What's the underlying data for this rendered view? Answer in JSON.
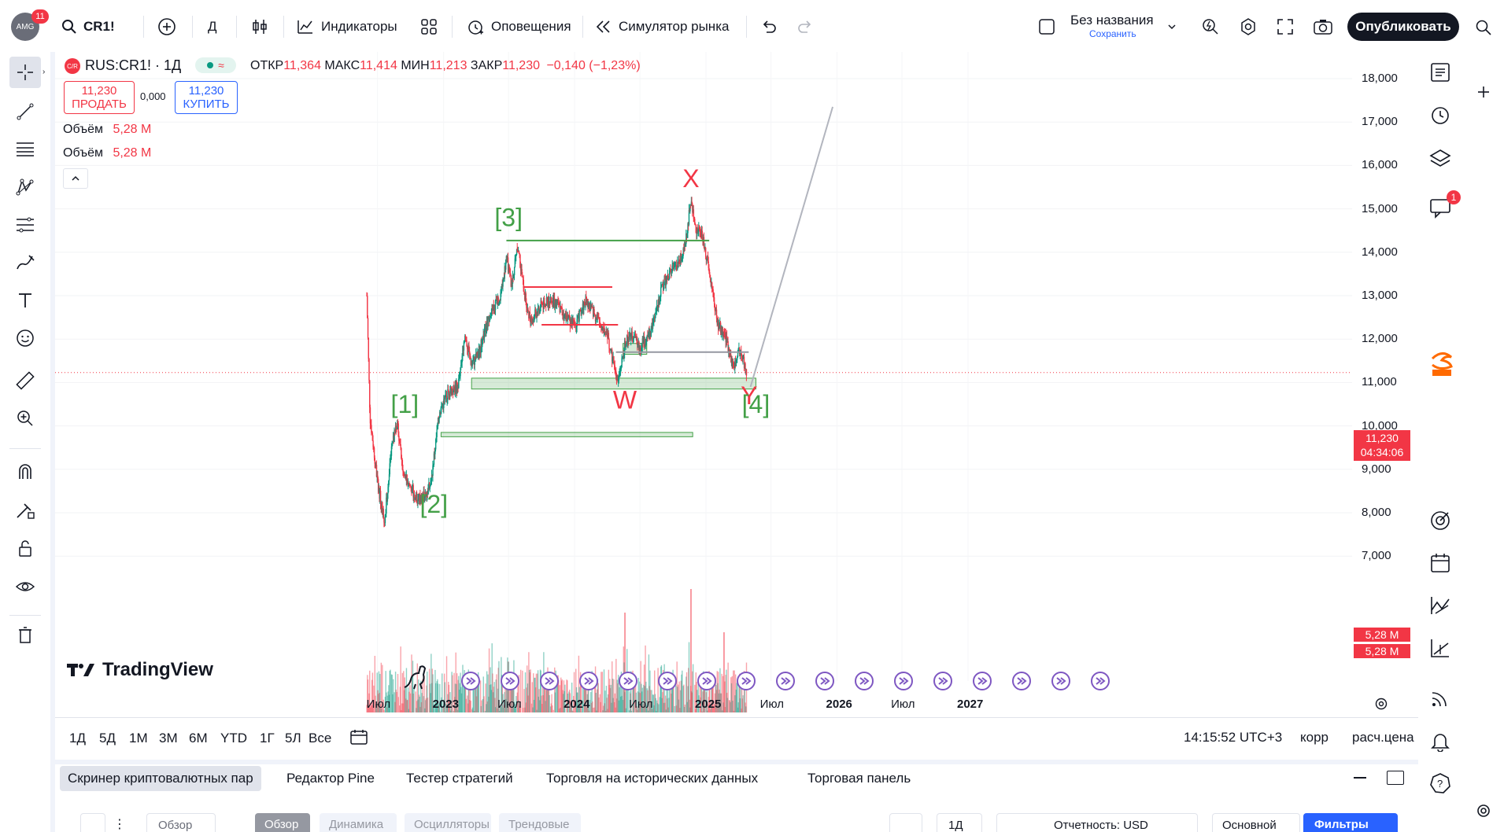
{
  "topbar": {
    "avatar_badge": "11",
    "avatar_text": "AMG",
    "symbol_search": "CR1!",
    "interval": "Д",
    "indicators_label": "Индикаторы",
    "alerts_label": "Оповещения",
    "replay_label": "Симулятор рынка",
    "layout_name": "Без названия",
    "layout_save": "Сохранить",
    "publish_label": "Опубликовать"
  },
  "legend": {
    "symbol": "RUS:CR1! · 1Д",
    "badge": "C/R",
    "open_label": "ОТКР",
    "open": "11,364",
    "high_label": "МАКС",
    "high": "11,414",
    "low_label": "МИН",
    "low": "11,213",
    "close_label": "ЗАКР",
    "close": "11,230",
    "change": "−0,140 (−1,23%)",
    "sell_price": "11,230",
    "sell_label": "ПРОДАТЬ",
    "spread": "0,000",
    "buy_price": "11,230",
    "buy_label": "КУПИТЬ",
    "volume_rows": [
      {
        "label": "Объём",
        "value": "5,28 M"
      },
      {
        "label": "Объём",
        "value": "5,28 M"
      }
    ]
  },
  "chart_data": {
    "type": "candlestick",
    "symbol": "RUS:CR1!",
    "interval": "1Д",
    "y_ticks": [
      "18,000",
      "17,000",
      "16,000",
      "15,000",
      "14,000",
      "13,000",
      "12,000",
      "11,000",
      "10,000",
      "9,000",
      "8,000",
      "7,000"
    ],
    "ylim": [
      6800,
      18300
    ],
    "x_ticks": [
      "Июл",
      "2023",
      "Июл",
      "2024",
      "Июл",
      "2025",
      "Июл",
      "2026",
      "Июл",
      "2027"
    ],
    "price_path": [
      [
        "2022-06-01",
        13000
      ],
      [
        "2022-06-10",
        10200
      ],
      [
        "2022-07-01",
        8700
      ],
      [
        "2022-07-20",
        7800
      ],
      [
        "2022-08-10",
        9500
      ],
      [
        "2022-08-25",
        10100
      ],
      [
        "2022-09-10",
        8900
      ],
      [
        "2022-10-01",
        8600
      ],
      [
        "2022-10-20",
        8300
      ],
      [
        "2022-11-15",
        8400
      ],
      [
        "2022-12-01",
        9000
      ],
      [
        "2022-12-20",
        10300
      ],
      [
        "2023-01-15",
        10800
      ],
      [
        "2023-02-10",
        10900
      ],
      [
        "2023-03-01",
        12100
      ],
      [
        "2023-03-20",
        11400
      ],
      [
        "2023-04-10",
        11700
      ],
      [
        "2023-05-10",
        12600
      ],
      [
        "2023-06-10",
        13000
      ],
      [
        "2023-06-25",
        13900
      ],
      [
        "2023-07-10",
        13200
      ],
      [
        "2023-07-25",
        14200
      ],
      [
        "2023-08-15",
        13000
      ],
      [
        "2023-09-01",
        12400
      ],
      [
        "2023-10-01",
        12800
      ],
      [
        "2023-11-01",
        12900
      ],
      [
        "2023-12-01",
        12600
      ],
      [
        "2024-01-01",
        12300
      ],
      [
        "2024-02-01",
        12900
      ],
      [
        "2024-03-01",
        12500
      ],
      [
        "2024-04-01",
        12100
      ],
      [
        "2024-05-01",
        11000
      ],
      [
        "2024-05-20",
        11900
      ],
      [
        "2024-06-10",
        12100
      ],
      [
        "2024-07-01",
        11800
      ],
      [
        "2024-08-01",
        12200
      ],
      [
        "2024-09-01",
        13200
      ],
      [
        "2024-10-01",
        13600
      ],
      [
        "2024-11-01",
        14000
      ],
      [
        "2024-11-20",
        15200
      ],
      [
        "2024-12-01",
        14600
      ],
      [
        "2024-12-20",
        14400
      ],
      [
        "2025-01-10",
        13600
      ],
      [
        "2025-02-01",
        12400
      ],
      [
        "2025-03-01",
        11900
      ],
      [
        "2025-03-20",
        11300
      ],
      [
        "2025-04-05",
        11800
      ],
      [
        "2025-04-25",
        11230
      ]
    ],
    "volume_series": [
      {
        "name": "Объём",
        "last": "5,28 M"
      },
      {
        "name": "Объём",
        "last": "5,28 M"
      }
    ],
    "annotations": [
      {
        "text": "[1]",
        "color": "#43a047",
        "x": "2022-09-15",
        "y": 10300
      },
      {
        "text": "[2]",
        "color": "#43a047",
        "x": "2022-12-05",
        "y": 8000
      },
      {
        "text": "[3]",
        "color": "#43a047",
        "x": "2023-07-01",
        "y": 14600
      },
      {
        "text": "X",
        "color": "#f23645",
        "x": "2024-11-20",
        "y": 15500
      },
      {
        "text": "W",
        "color": "#f23645",
        "x": "2024-05-20",
        "y": 10400
      },
      {
        "text": "Y",
        "color": "#f23645",
        "x": "2025-05-01",
        "y": 10500
      },
      {
        "text": "[4]",
        "color": "#43a047",
        "x": "2025-05-20",
        "y": 10300
      }
    ],
    "lines": [
      {
        "kind": "hline",
        "color": "#43a047",
        "from": "2023-06-25",
        "to": "2025-01-10",
        "y": 14270
      },
      {
        "kind": "hline",
        "color": "#f23645",
        "from": "2023-08-10",
        "to": "2024-04-15",
        "y": 13200
      },
      {
        "kind": "hline",
        "color": "#f23645",
        "from": "2023-10-01",
        "to": "2024-05-01",
        "y": 12330
      },
      {
        "kind": "hline",
        "color": "#9598a1",
        "from": "2024-04-25",
        "to": "2025-04-30",
        "y": 11700
      },
      {
        "kind": "trend",
        "color": "#b2b5be",
        "from": [
          "2025-05-05",
          10900
        ],
        "to": [
          "2025-12-20",
          17350
        ]
      }
    ],
    "zones": [
      {
        "color": "#43a047",
        "from": "2023-03-20",
        "to": "2025-05-20",
        "y1": 10850,
        "y2": 11100
      },
      {
        "color": "#43a047",
        "from": "2022-12-25",
        "to": "2024-11-25",
        "y1": 9750,
        "y2": 9850
      },
      {
        "color": "#43a047",
        "from": "2024-05-15",
        "to": "2024-07-20",
        "y1": 11650,
        "y2": 11900
      }
    ],
    "last_price": "11,230",
    "countdown": "04:34:06",
    "volume_labels": [
      "5,28 M",
      "5,28 M"
    ],
    "grid": true
  },
  "chart_footer": {
    "ranges": [
      "1Д",
      "5Д",
      "1М",
      "3М",
      "6М",
      "YTD",
      "1Г",
      "5Л",
      "Все"
    ],
    "clock": "14:15:52 UTC+3",
    "adj": "корр",
    "settlement": "расч.цена"
  },
  "bottom_panel": {
    "tabs": [
      "Скринер криптовалютных пар",
      "Редактор Pine",
      "Тестер стратегий",
      "Торговля на исторических данных",
      "Торговая панель"
    ],
    "filters_label": "Фильтры",
    "sub_buttons": [
      "Обзор",
      "Обзор",
      "Динамика",
      "Осцилляторы",
      "Трендовые"
    ],
    "period": "1Д",
    "report": "Отчетность: USD",
    "main": "Основной"
  },
  "branding": {
    "logo": "TradingView",
    "rightbar_badge": "1"
  }
}
